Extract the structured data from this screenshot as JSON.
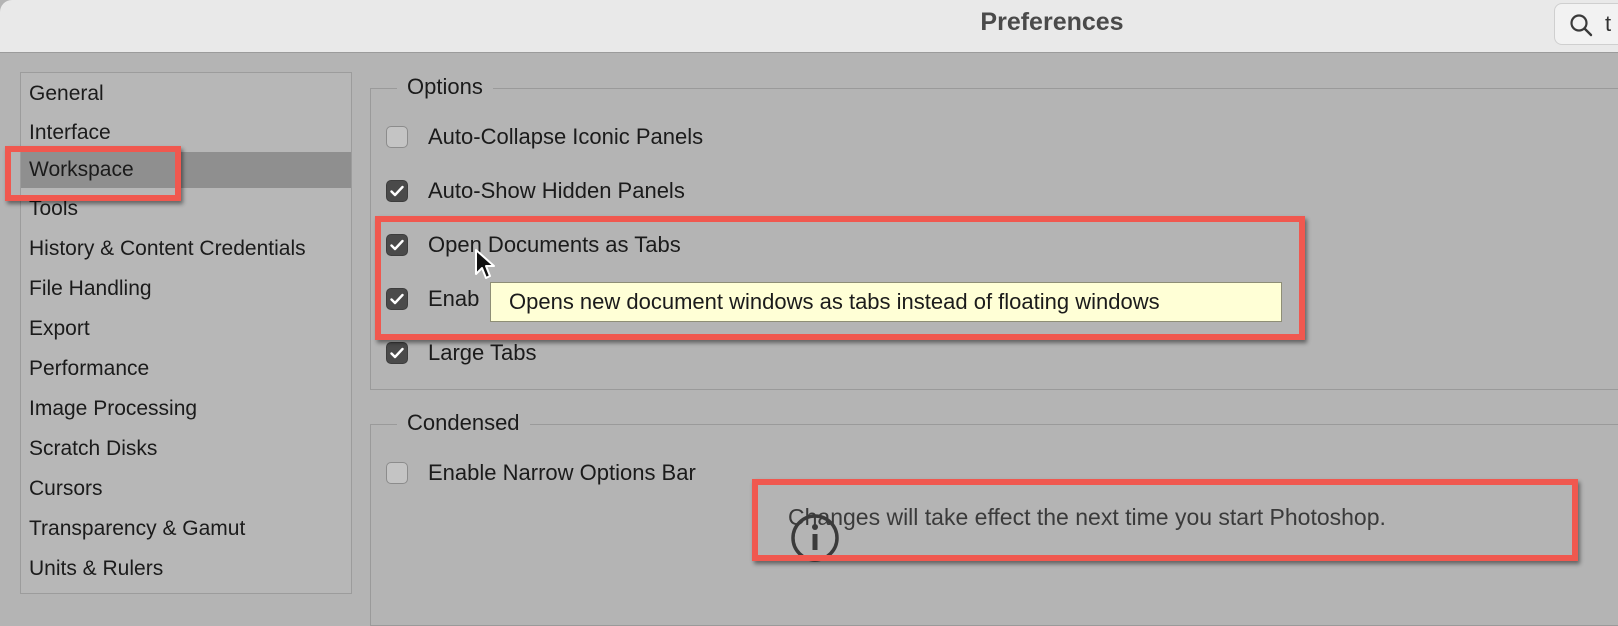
{
  "window": {
    "title": "Preferences"
  },
  "search": {
    "value": "t"
  },
  "sidebar": {
    "items": [
      {
        "label": "General"
      },
      {
        "label": "Interface"
      },
      {
        "label": "Workspace",
        "selected": true
      },
      {
        "label": "Tools"
      },
      {
        "label": "History & Content Credentials"
      },
      {
        "label": "File Handling"
      },
      {
        "label": "Export"
      },
      {
        "label": "Performance"
      },
      {
        "label": "Image Processing"
      },
      {
        "label": "Scratch Disks"
      },
      {
        "label": "Cursors"
      },
      {
        "label": "Transparency & Gamut"
      },
      {
        "label": "Units & Rulers"
      }
    ]
  },
  "options": {
    "legend": "Options",
    "items": [
      {
        "label": "Auto-Collapse Iconic Panels",
        "checked": false
      },
      {
        "label": "Auto-Show Hidden Panels",
        "checked": true
      },
      {
        "label": "Open Documents as Tabs",
        "checked": true
      },
      {
        "label": "Enab",
        "checked": true
      },
      {
        "label": "Large Tabs",
        "checked": true
      }
    ]
  },
  "condensed": {
    "legend": "Condensed",
    "items": [
      {
        "label": "Enable Narrow Options Bar",
        "checked": false
      }
    ]
  },
  "tooltip": {
    "text": "Opens new document windows as tabs instead of floating windows"
  },
  "notice": {
    "text": "Changes will take effect the next time you start Photoshop."
  },
  "colors": {
    "highlight": "#f0584f",
    "tooltip_bg": "#ffffd6",
    "selected": "#8f8f8f"
  }
}
